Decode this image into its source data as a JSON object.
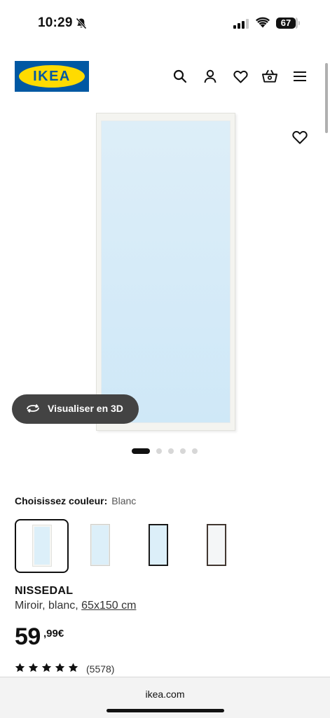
{
  "status_bar": {
    "time": "10:29",
    "battery": "67"
  },
  "header": {
    "logo_text": "IKEA",
    "icons": [
      "search-icon",
      "user-icon",
      "heart-icon",
      "cart-icon",
      "menu-icon"
    ]
  },
  "gallery": {
    "view_3d_label": "Visualiser en 3D",
    "dot_count": 5,
    "active_dot": 0
  },
  "color_picker": {
    "label": "Choisissez couleur:",
    "selected": "Blanc",
    "swatches": [
      "white-frame",
      "white-thin-frame",
      "black-frame",
      "dark-brown-frame"
    ]
  },
  "product": {
    "name": "NISSEDAL",
    "description": "Miroir, blanc, ",
    "size": "65x150 cm",
    "price_int": "59",
    "price_dec": ",99€",
    "rating_stars": 5,
    "rating_count": "(5578)"
  },
  "browser": {
    "url": "ikea.com"
  },
  "colors": {
    "ikea_blue": "#0058a3",
    "ikea_yellow": "#ffdb00",
    "text": "#111111"
  }
}
